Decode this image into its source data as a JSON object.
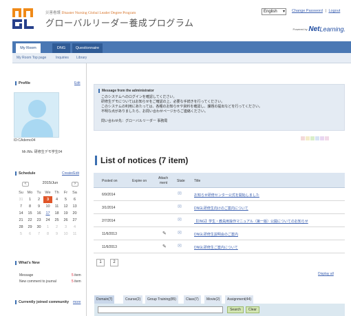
{
  "header": {
    "program_en_prefix": "災害看護",
    "program_en": "Disaster Nursing Global Leader Degree Program",
    "program_jp": "グローバルリーダー養成プログラム",
    "language": "English",
    "change_password": "Change Password",
    "separator": "|",
    "logout": "Logout",
    "powered_by": "Powered by",
    "brand_net": "Net",
    "brand_learning": "Learning."
  },
  "tabs": [
    "My Room",
    "DNG",
    "Questionnaire"
  ],
  "subtabs": [
    "My Room Top page",
    "Inquiries",
    "Library"
  ],
  "profile": {
    "title": "Profile",
    "edit": "Edit",
    "id": "ID:CAdemo04",
    "name": "Mr./Ms. 研修生デモ学生04"
  },
  "schedule": {
    "title": "Schedule",
    "create_edit": "Create/Edit",
    "month": "2015/Jun",
    "prev": "<",
    "next": ">",
    "day_names": [
      "Su",
      "Mo",
      "Tu",
      "We",
      "Th",
      "Fr",
      "Sa"
    ],
    "weeks": [
      [
        "31",
        "1",
        "2",
        "3",
        "4",
        "5",
        "6"
      ],
      [
        "7",
        "8",
        "9",
        "10",
        "11",
        "12",
        "13"
      ],
      [
        "14",
        "15",
        "16",
        "17",
        "18",
        "19",
        "20"
      ],
      [
        "21",
        "22",
        "23",
        "24",
        "25",
        "26",
        "27"
      ],
      [
        "28",
        "29",
        "30",
        "1",
        "2",
        "3",
        "4"
      ],
      [
        "5",
        "6",
        "7",
        "8",
        "9",
        "10",
        "11"
      ]
    ],
    "today": "3"
  },
  "whats_new": {
    "title": "What's New",
    "items": [
      {
        "label": "Message",
        "count": "5",
        "unit": "item"
      },
      {
        "label": "New comment to journal",
        "count": "5",
        "unit": "item"
      }
    ]
  },
  "communities": {
    "title": "Currently joined community",
    "more": "more"
  },
  "admin_message": {
    "title": "Message from the administrator",
    "lines": [
      "このシステムへのログインを確認してください。",
      "研修生デモについてはお知らせをご確認の上、必要な手続きを行ってください。",
      "このシステムの利用にあたっては、各種のお知らせや資料を確認し、課題の提出などを行ってください。",
      "不明な点がありましたら、お問い合わせページからご連絡ください。",
      "",
      "問い合わせ先：グローバルリーダー 事務局"
    ]
  },
  "notices": {
    "title": "List of notices (7 item)",
    "headers": {
      "posted_on": "Posted on",
      "expire_on": "Expire on",
      "attachment_1": "Attach",
      "attachment_2": "ment",
      "state": "State",
      "title": "Title"
    },
    "rows": [
      {
        "posted_on": "6/9/2014",
        "attach": "",
        "state": "✉",
        "title": "お知らせ研修センター公式を開始しました"
      },
      {
        "posted_on": "3/1/2014",
        "attach": "",
        "state": "✉",
        "title": "DNGL研修生向けのご案内について"
      },
      {
        "posted_on": "2/7/2014",
        "attach": "",
        "state": "✉",
        "title": "【DNG】学生・教員用操作マニュアル（第一版）公開についてのお知らせ"
      },
      {
        "posted_on": "11/6/2013",
        "attach": "✎",
        "state": "✉",
        "title": "DNGL研修生説明会のご案内"
      },
      {
        "posted_on": "11/6/2013",
        "attach": "✎",
        "state": "✉",
        "title": "DNGL研修生ご案内について"
      }
    ],
    "pages": [
      "1",
      "2"
    ],
    "display_all": "Display all"
  },
  "bottom_tabs": [
    "Domain(7)",
    "Course(2)",
    "Group Training(85)",
    "Class(7)",
    "Movie(2)",
    "Assignment(44)"
  ],
  "search": {
    "value": "",
    "search_label": "Search",
    "clear_label": "Clear"
  },
  "colors": {
    "accent": "#4a78b4",
    "brand_orange": "#f08a18",
    "brand_navy": "#27408b",
    "today": "#e05528",
    "swatches": [
      "#f3d9d9",
      "#f4ecc9",
      "#d9eec9",
      "#d6e2f4",
      "#e8d6f1",
      "#f1d9e8"
    ]
  }
}
